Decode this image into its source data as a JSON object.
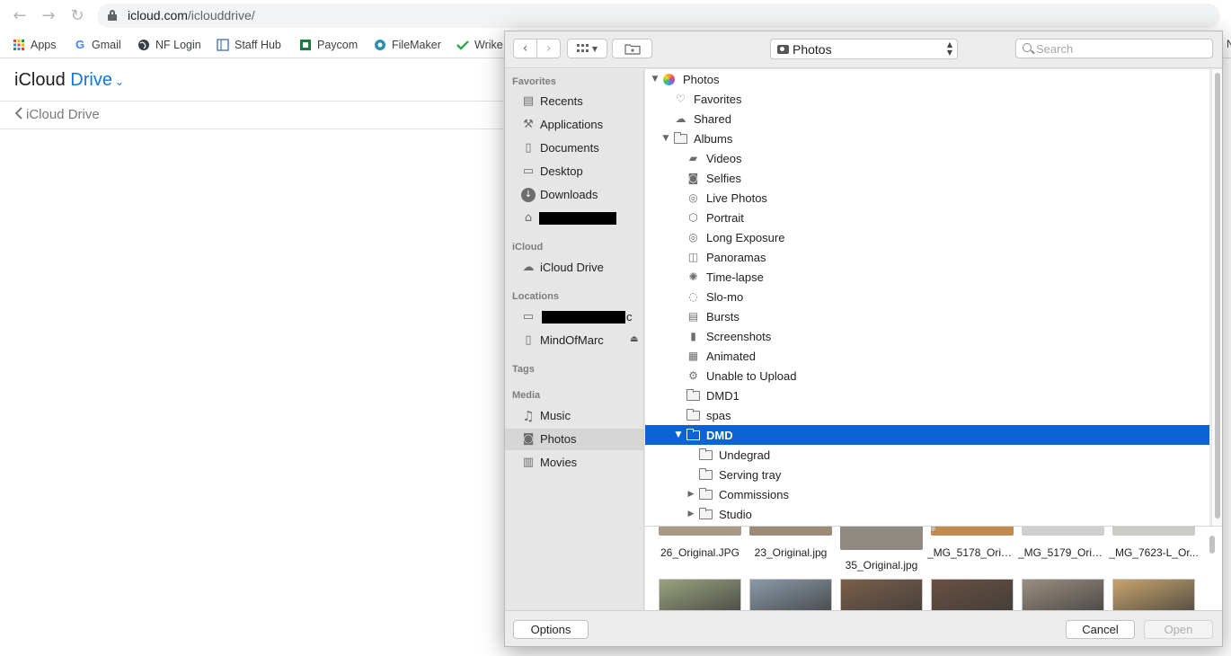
{
  "browser": {
    "url_host": "icloud.com",
    "url_path": "/iclouddrive/",
    "bookmarks": [
      {
        "label": "Apps",
        "icon": "apps-grid-icon"
      },
      {
        "label": "Gmail",
        "icon": "google-g-icon"
      },
      {
        "label": "NF Login",
        "icon": "globe-icon"
      },
      {
        "label": "Staff Hub",
        "icon": "staffhub-icon"
      },
      {
        "label": "Paycom",
        "icon": "paycom-icon"
      },
      {
        "label": "FileMaker",
        "icon": "filemaker-icon"
      },
      {
        "label": "Wrike",
        "icon": "wrike-check-icon"
      }
    ],
    "right_edge_text": "N"
  },
  "icloud": {
    "title_prefix": "iCloud",
    "title_suffix": "Drive",
    "back_label": "iCloud Drive"
  },
  "dialog": {
    "location_popup": "Photos",
    "search_placeholder": "Search",
    "sidebar": {
      "sections": [
        {
          "header": "Favorites",
          "items": [
            {
              "label": "Recents",
              "icon": "recents-icon"
            },
            {
              "label": "Applications",
              "icon": "applications-icon"
            },
            {
              "label": "Documents",
              "icon": "documents-icon"
            },
            {
              "label": "Desktop",
              "icon": "desktop-icon"
            },
            {
              "label": "Downloads",
              "icon": "downloads-icon"
            },
            {
              "label": "",
              "icon": "home-icon",
              "redacted": true
            }
          ]
        },
        {
          "header": "iCloud",
          "items": [
            {
              "label": "iCloud Drive",
              "icon": "cloud-icon"
            }
          ]
        },
        {
          "header": "Locations",
          "items": [
            {
              "label": "c",
              "icon": "computer-icon",
              "redacted": true
            },
            {
              "label": "MindOfMarc",
              "icon": "disk-icon",
              "eject": true
            }
          ]
        },
        {
          "header": "Tags",
          "items": []
        },
        {
          "header": "Media",
          "items": [
            {
              "label": "Music",
              "icon": "music-note-icon"
            },
            {
              "label": "Photos",
              "icon": "camera-icon",
              "selected": true
            },
            {
              "label": "Movies",
              "icon": "film-icon"
            }
          ]
        }
      ]
    },
    "outline": [
      {
        "label": "Photos",
        "level": 0,
        "disclosure": "open",
        "icon": "photos-app-icon"
      },
      {
        "label": "Favorites",
        "level": 1,
        "icon": "heart-icon"
      },
      {
        "label": "Shared",
        "level": 1,
        "icon": "cloud-icon"
      },
      {
        "label": "Albums",
        "level": 1,
        "disclosure": "open",
        "icon": "folder-icon"
      },
      {
        "label": "Videos",
        "level": 2,
        "icon": "video-camera-icon"
      },
      {
        "label": "Selfies",
        "level": 2,
        "icon": "selfie-camera-icon"
      },
      {
        "label": "Live Photos",
        "level": 2,
        "icon": "live-photo-icon"
      },
      {
        "label": "Portrait",
        "level": 2,
        "icon": "cube-icon"
      },
      {
        "label": "Long Exposure",
        "level": 2,
        "icon": "long-exposure-icon"
      },
      {
        "label": "Panoramas",
        "level": 2,
        "icon": "panorama-icon"
      },
      {
        "label": "Time-lapse",
        "level": 2,
        "icon": "time-lapse-icon"
      },
      {
        "label": "Slo-mo",
        "level": 2,
        "icon": "slo-mo-icon"
      },
      {
        "label": "Bursts",
        "level": 2,
        "icon": "bursts-icon"
      },
      {
        "label": "Screenshots",
        "level": 2,
        "icon": "phone-icon"
      },
      {
        "label": "Animated",
        "level": 2,
        "icon": "animated-icon"
      },
      {
        "label": "Unable to Upload",
        "level": 2,
        "icon": "upload-error-icon"
      },
      {
        "label": "DMD1",
        "level": 2,
        "icon": "folder-icon"
      },
      {
        "label": "spas",
        "level": 2,
        "icon": "folder-icon"
      },
      {
        "label": "DMD",
        "level": 2,
        "disclosure": "open",
        "icon": "folder-icon",
        "selected": true
      },
      {
        "label": "Undegrad",
        "level": 3,
        "icon": "album-icon"
      },
      {
        "label": "Serving tray",
        "level": 3,
        "icon": "album-icon"
      },
      {
        "label": "Commissions",
        "level": 3,
        "disclosure": "closed",
        "icon": "folder-icon"
      },
      {
        "label": "Studio",
        "level": 3,
        "disclosure": "closed",
        "icon": "folder-icon"
      }
    ],
    "thumbnails_row1": [
      {
        "caption": "26_Original.JPG",
        "tone": "#a99a86"
      },
      {
        "caption": "23_Original.jpg",
        "tone": "#9c8b76"
      },
      {
        "caption": "35_Original.jpg",
        "tone": "#8e8a82"
      },
      {
        "caption": "_MG_5178_Origi...",
        "tone": "#c28a4c"
      },
      {
        "caption": "_MG_5179_Origi...",
        "tone": "#cfcfcf"
      },
      {
        "caption": "_MG_7623-L_Or...",
        "tone": "#c9cbc4"
      }
    ],
    "thumbnails_row2": [
      {
        "tone": "#9aa37e"
      },
      {
        "tone": "#8a9aa8"
      },
      {
        "tone": "#7b5e48"
      },
      {
        "tone": "#6a5040"
      },
      {
        "tone": "#9b8e80"
      },
      {
        "tone": "#c9a46c"
      }
    ],
    "buttons": {
      "options": "Options",
      "cancel": "Cancel",
      "open": "Open"
    }
  }
}
